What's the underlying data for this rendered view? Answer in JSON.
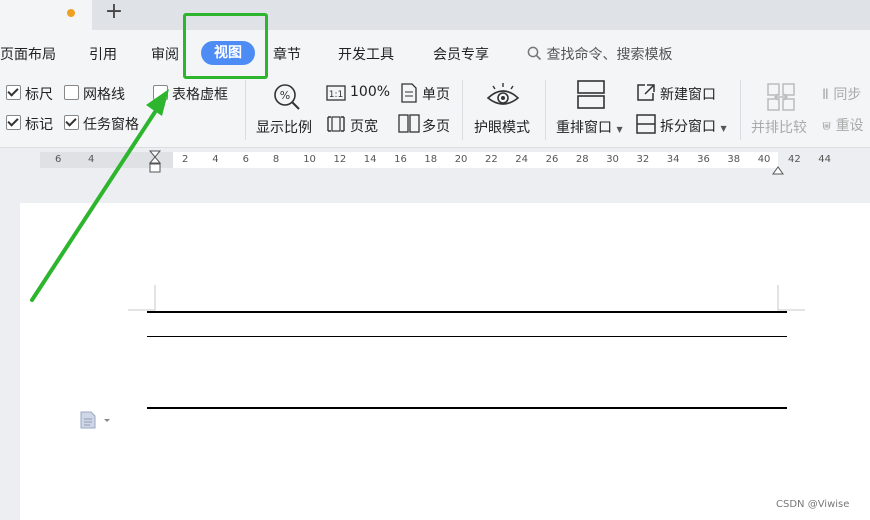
{
  "tabs": {
    "new_tab": "+"
  },
  "menu": {
    "items": [
      "页面布局",
      "引用",
      "审阅",
      "视图",
      "章节",
      "开发工具",
      "会员专享"
    ],
    "search_placeholder": "查找命令、搜索模板"
  },
  "ribbon": {
    "show": {
      "ruler": {
        "label": "标尺",
        "checked": true
      },
      "gridlines": {
        "label": "网格线",
        "checked": false
      },
      "table_gridlines": {
        "label": "表格虚框",
        "checked": false
      },
      "marks": {
        "label": "标记",
        "checked": true
      },
      "task_pane": {
        "label": "任务窗格",
        "checked": true
      }
    },
    "zoom": {
      "label": "显示比例",
      "percent": "100%",
      "page_width": "页宽",
      "single_page": "单页",
      "multi_page": "多页"
    },
    "eye_protection": "护眼模式",
    "arrange_window": "重排窗口",
    "new_window": "新建窗口",
    "split_window": "拆分窗口",
    "compare_side_by_side": "并排比较",
    "sync_scroll": "同步",
    "reset_window": "重设"
  },
  "ruler": {
    "left_ticks": [
      "6",
      "4"
    ],
    "ticks": [
      "2",
      "4",
      "6",
      "8",
      "10",
      "12",
      "14",
      "16",
      "18",
      "20",
      "22",
      "24",
      "26",
      "28",
      "30",
      "32",
      "34",
      "36",
      "38",
      "40",
      "42",
      "44"
    ]
  },
  "watermark": "CSDN @Viwise",
  "colors": {
    "accent": "#4d8cf4",
    "annotation": "#2db52d"
  }
}
